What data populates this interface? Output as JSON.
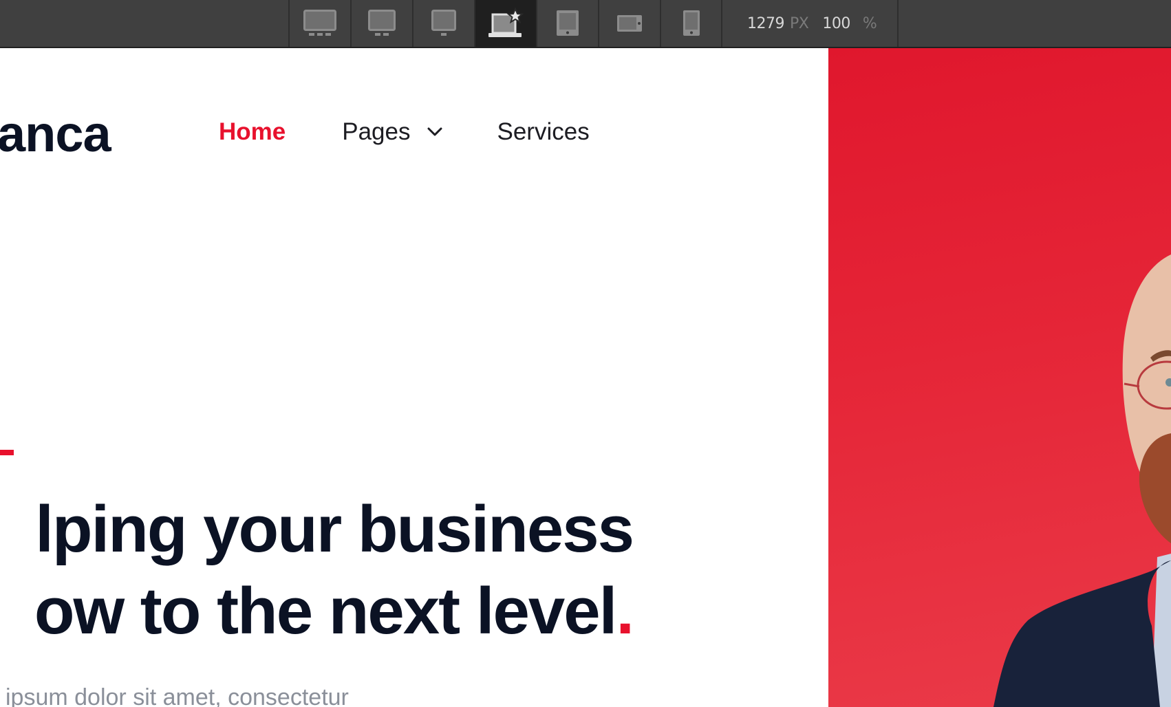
{
  "toolbar": {
    "breakpoints": [
      {
        "name": "large-desktop",
        "icon": "desktop-large-icon",
        "active": false
      },
      {
        "name": "desktop-medium",
        "icon": "desktop-medium-icon",
        "active": false
      },
      {
        "name": "desktop-small",
        "icon": "desktop-small-icon",
        "active": false
      },
      {
        "name": "laptop-base",
        "icon": "laptop-star-icon",
        "active": true
      },
      {
        "name": "tablet",
        "icon": "tablet-icon",
        "active": false
      },
      {
        "name": "mobile-landscape",
        "icon": "mobile-landscape-icon",
        "active": false
      },
      {
        "name": "mobile-portrait",
        "icon": "mobile-portrait-icon",
        "active": false
      }
    ],
    "width_value": "1279",
    "width_unit": "PX",
    "zoom_value": "100",
    "zoom_unit": "%"
  },
  "site": {
    "logo_text": "anca",
    "nav": [
      {
        "label": "Home",
        "active": true
      },
      {
        "label": "Pages",
        "has_dropdown": true
      },
      {
        "label": "Services"
      }
    ],
    "hero": {
      "headline_line1": "lping your business",
      "headline_line2": "ow to the next level",
      "headline_dot": ".",
      "subtext": "ipsum dolor sit amet, consectetur",
      "image": "portrait-man-glasses-red-background"
    }
  },
  "colors": {
    "accent": "#e8112d",
    "heading": "#0b1224",
    "toolbar_bg": "#404040",
    "toolbar_active_bg": "#1f1f1f",
    "subtext": "#8a8f99"
  }
}
